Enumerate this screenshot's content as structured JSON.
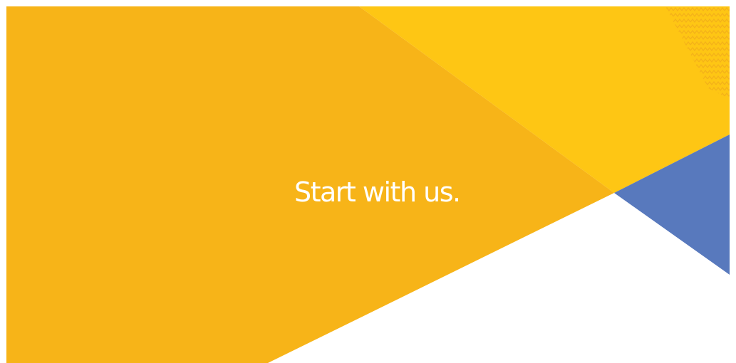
{
  "banner": {
    "headline": "Start with us.",
    "colors": {
      "primary_yellow": "#F7B418",
      "light_yellow": "#FEC614",
      "blue": "#5879BD",
      "background": "#FFFFFF"
    },
    "decoration": "zigzag-pattern"
  }
}
